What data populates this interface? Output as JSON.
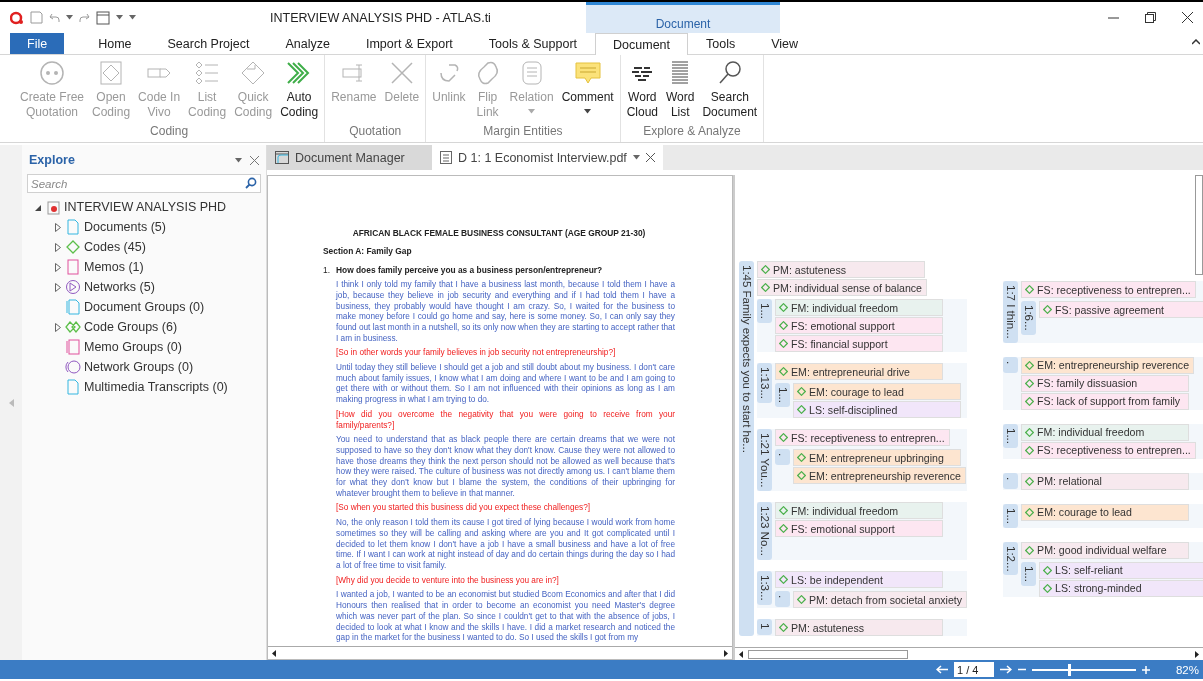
{
  "window": {
    "title": "INTERVIEW ANALYSIS PHD - ATLAS.ti",
    "context_tab": "Document"
  },
  "tabs": [
    {
      "label": "File",
      "kind": "file",
      "selected": false
    },
    {
      "label": "Home",
      "kind": "tab",
      "selected": false
    },
    {
      "label": "Search Project",
      "kind": "tab",
      "selected": false
    },
    {
      "label": "Analyze",
      "kind": "tab",
      "selected": false
    },
    {
      "label": "Import & Export",
      "kind": "tab",
      "selected": false
    },
    {
      "label": "Tools & Support",
      "kind": "tab",
      "selected": false
    },
    {
      "label": "Document",
      "kind": "tab",
      "selected": true
    },
    {
      "label": "Tools",
      "kind": "tab",
      "selected": false
    },
    {
      "label": "View",
      "kind": "tab",
      "selected": false
    }
  ],
  "ribbon": {
    "groups": [
      {
        "name": "Coding",
        "buttons": [
          {
            "label": "Create Free\nQuotation",
            "disabled": true
          },
          {
            "label": "Open\nCoding",
            "disabled": true
          },
          {
            "label": "Code In\nVivo",
            "disabled": true
          },
          {
            "label": "List\nCoding",
            "disabled": true
          },
          {
            "label": "Quick\nCoding",
            "disabled": true
          },
          {
            "label": "Auto\nCoding",
            "disabled": false
          }
        ]
      },
      {
        "name": "Quotation",
        "buttons": [
          {
            "label": "Rename",
            "disabled": true
          },
          {
            "label": "Delete",
            "disabled": true
          }
        ]
      },
      {
        "name": "Margin Entities",
        "buttons": [
          {
            "label": "Unlink",
            "disabled": true
          },
          {
            "label": "Flip\nLink",
            "disabled": true
          },
          {
            "label": "Relation",
            "disabled": true,
            "dropdown": true
          },
          {
            "label": "Comment",
            "disabled": false,
            "dropdown": true
          }
        ]
      },
      {
        "name": "Explore & Analyze",
        "buttons": [
          {
            "label": "Word\nCloud",
            "disabled": false
          },
          {
            "label": "Word\nList",
            "disabled": false
          },
          {
            "label": "Search\nDocument",
            "disabled": false
          }
        ]
      }
    ]
  },
  "explore": {
    "title": "Explore",
    "search": {
      "placeholder": "Search"
    },
    "tree": {
      "label": "INTERVIEW ANALYSIS PHD",
      "expanded": true,
      "children": [
        {
          "label": "Documents (5)",
          "expanded": false
        },
        {
          "label": "Codes (45)",
          "expanded": false
        },
        {
          "label": "Memos (1)",
          "expanded": false
        },
        {
          "label": "Networks (5)",
          "expanded": false
        },
        {
          "label": "Document Groups (0)"
        },
        {
          "label": "Code Groups (6)",
          "expanded": false
        },
        {
          "label": "Memo Groups (0)"
        },
        {
          "label": "Network Groups (0)"
        },
        {
          "label": "Multimedia Transcripts (0)"
        }
      ]
    }
  },
  "doc_tabs": [
    {
      "label": "Document Manager",
      "selected": false
    },
    {
      "label": "D 1: 1 Economist Interview.pdf",
      "selected": true
    }
  ],
  "document": {
    "title": "AFRICAN BLACK FEMALE BUSINESS CONSULTANT (AGE GROUP 21-30)",
    "section": "Section A: Family Gap",
    "question_number": "1.",
    "question": "How does family perceive you as a business person/entrepreneur?",
    "paragraphs": [
      {
        "kind": "answer",
        "text": "I think I only told my family that I have a business last month, because I told them I have a job, because they believe in job security and everything and if I had told them I have a business, they probably would have thought I am crazy. So, I waited for the business to make money before I could go home and say, here is some money. So, I can only say they found out last month in a nutshell, so its only now when they are starting to accept rather that I am in business."
      },
      {
        "kind": "interviewer",
        "text": "[So in other words your family believes in job security not entrepreneurship?]"
      },
      {
        "kind": "answer",
        "text": "Until today they still believe I should get a job and still doubt about my business. I don't care much about family issues, I know what I am doing and where I want to be and I am going to get there with or without them. So I am not influenced with their opinions as long as I am making progress in what I am trying to do."
      },
      {
        "kind": "interviewer",
        "text": "[How did you overcome the negativity that you were going to receive from your family/parents?]"
      },
      {
        "kind": "answer",
        "text": "You need to understand that as black people there are certain dreams that we were not supposed to have so they don't know what they don't know. Cause they were not allowed to have those dreams they think the next person should not be allowed as well because that's how they were raised. The culture of business was not directly among us. I can't blame them for what they don't know but I blame the system, the conditions of their upbringing for whatever brought them to believe in that manner."
      },
      {
        "kind": "interviewer",
        "text": "[So when you started this business did you expect these challenges?]"
      },
      {
        "kind": "answer",
        "text": "No, the only reason I told them its cause I got tired of lying because I would work from home sometimes so they will be calling and asking where are you and It got complicated until I decided to let them know I don't have a job I have a small business  and have a lot of free time. If I want I can work at night instead of day and do certain things during the day so I had a lot of free time to visit family."
      },
      {
        "kind": "interviewer",
        "text": "[Why did you decide to venture into the business you are in?]"
      },
      {
        "kind": "answer",
        "text": "I wanted a job, I wanted to be an economist but studied Bcom Economics and after that I did Honours then realised that in order to become an economist you need Master's degree which was never part of the plan. So since I couldn't get to that with the absence of jobs, I decided to look at what I know and the skills I have. I did a market research and noticed the gap in the market for the business I wanted to do. So I used the skills I got from my"
      }
    ]
  },
  "margin": {
    "columns": [
      [
        {
          "quotation": "1:45 Family expects you to start he...",
          "codes": [
            {
              "label": "PM: astuteness",
              "color": "#f7e9ee"
            },
            {
              "label": "PM: individual sense of balance",
              "color": "#f7e9ee"
            }
          ],
          "children": [
            {
              "quotation": "1...",
              "codes": [
                {
                  "label": "FM: individual freedom",
                  "color": "#e8f2ee"
                },
                {
                  "label": "FS: emotional support",
                  "color": "#fde6f1"
                },
                {
                  "label": "FS: financial support",
                  "color": "#fde6f1"
                }
              ]
            },
            {
              "quotation": "1:13...",
              "codes": [
                {
                  "label": "EM: entrepreneurial drive",
                  "color": "#fde5d0"
                }
              ],
              "children": [
                {
                  "quotation": "1...",
                  "codes": [
                    {
                      "label": "EM: courage to lead",
                      "color": "#fde5d0"
                    },
                    {
                      "label": "LS: self-disciplined",
                      "color": "#f1e6fa"
                    }
                  ]
                }
              ]
            },
            {
              "quotation": "1:21 You...",
              "codes": [
                {
                  "label": "FS: receptiveness to entrepren...",
                  "color": "#fde6f1"
                }
              ],
              "children": [
                {
                  "quotation": ".",
                  "codes": [
                    {
                      "label": "EM: entrepreneur upbringing",
                      "color": "#fde5d0"
                    },
                    {
                      "label": "EM: entrepreneurship reverence",
                      "color": "#fde5d0"
                    }
                  ]
                }
              ]
            },
            {
              "quotation": "1:23 No...",
              "codes": [
                {
                  "label": "FM: individual freedom",
                  "color": "#e8f2ee"
                },
                {
                  "label": "FS: emotional support",
                  "color": "#fde6f1"
                }
              ]
            },
            {
              "quotation": "1:3...",
              "codes": [
                {
                  "label": "LS: be independent",
                  "color": "#f1e6fa"
                }
              ],
              "children": [
                {
                  "quotation": ".",
                  "codes": [
                    {
                      "label": "PM: detach from societal anxiety",
                      "color": "#f7e9ee"
                    }
                  ]
                }
              ]
            },
            {
              "quotation": "1",
              "codes": [
                {
                  "label": "PM: astuteness",
                  "color": "#f7e9ee"
                }
              ]
            }
          ]
        }
      ],
      [
        {
          "quotation": "1:7 I thin...",
          "codes": [
            {
              "label": "FS: receptiveness to entrepren...",
              "color": "#fde6f1"
            }
          ],
          "children": [
            {
              "quotation": "1:6...",
              "codes": [
                {
                  "label": "FS: passive agreement",
                  "color": "#fde6f1"
                }
              ]
            }
          ]
        },
        {
          "quotation": ".",
          "codes": [
            {
              "label": "EM: entrepreneurship reverence",
              "color": "#fde5d0"
            },
            {
              "label": "FS: family dissuasion",
              "color": "#fde6f1"
            },
            {
              "label": "FS: lack of support from family",
              "color": "#fde6f1"
            }
          ]
        },
        {
          "quotation": "1...",
          "codes": [
            {
              "label": "FM: individual freedom",
              "color": "#e8f2ee"
            },
            {
              "label": "FS: receptiveness to entrepren...",
              "color": "#fde6f1"
            }
          ]
        },
        {
          "quotation": ".",
          "codes": [
            {
              "label": "PM: relational",
              "color": "#f7e9ee"
            }
          ]
        },
        {
          "quotation": "1...",
          "codes": [
            {
              "label": "EM: courage to lead",
              "color": "#fde5d0"
            }
          ]
        },
        {
          "quotation": "1:2...",
          "codes": [
            {
              "label": "PM: good individual welfare",
              "color": "#f7e9ee"
            }
          ],
          "children": [
            {
              "quotation": "1...",
              "codes": [
                {
                  "label": "LS: self-reliant",
                  "color": "#f1e6fa"
                },
                {
                  "label": "LS: strong-minded",
                  "color": "#f1e6fa"
                }
              ]
            }
          ]
        }
      ]
    ]
  },
  "status_bar": {
    "page": "1 / 4",
    "zoom": {
      "level": 0.35
    },
    "zoom_label": "82%"
  }
}
